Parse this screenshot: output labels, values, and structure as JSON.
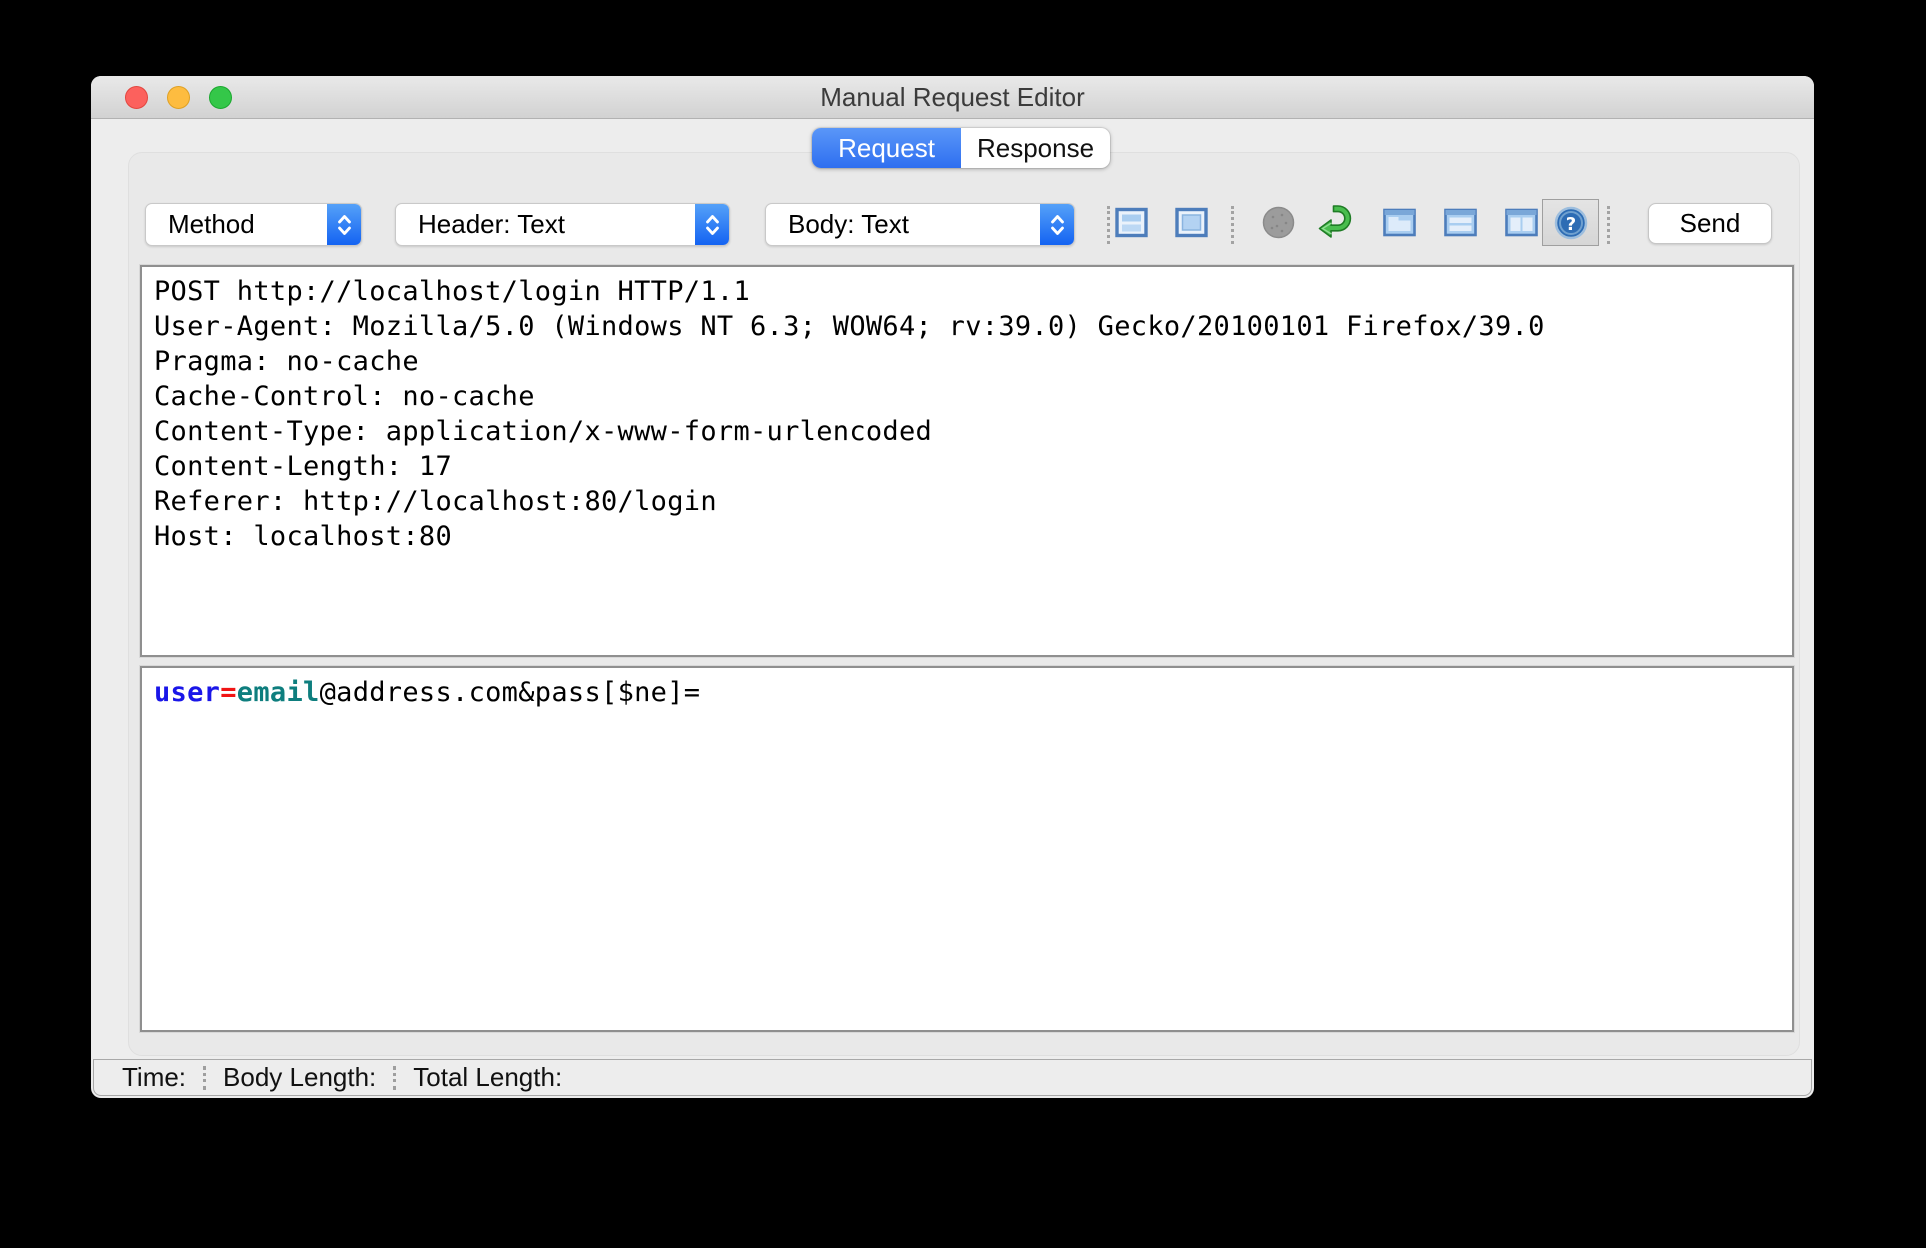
{
  "window": {
    "title": "Manual Request Editor"
  },
  "tabs": {
    "request": {
      "label": "Request",
      "selected": true
    },
    "response": {
      "label": "Response",
      "selected": false
    }
  },
  "toolbar": {
    "method_dropdown": {
      "value": "Method"
    },
    "header_dropdown": {
      "value": "Header: Text"
    },
    "body_dropdown": {
      "value": "Body: Text"
    },
    "icons": [
      "combined-view-icon",
      "single-view-icon",
      "break-icon",
      "follow-redirects-icon",
      "tab-view-icon",
      "horizontal-split-view-icon",
      "vertical-split-view-icon",
      "help-icon"
    ],
    "send_label": "Send"
  },
  "request": {
    "header_lines": [
      "POST http://localhost/login HTTP/1.1",
      "User-Agent: Mozilla/5.0 (Windows NT 6.3; WOW64; rv:39.0) Gecko/20100101 Firefox/39.0",
      "Pragma: no-cache",
      "Cache-Control: no-cache",
      "Content-Type: application/x-www-form-urlencoded",
      "Content-Length: 17",
      "Referer: http://localhost:80/login",
      "Host: localhost:80"
    ],
    "body_segments": {
      "param": "user",
      "equals": "=",
      "value_highlight": "email",
      "rest": "@address.com&pass[$ne]="
    }
  },
  "status_bar": {
    "time_label": "Time:",
    "body_length_label": "Body Length:",
    "total_length_label": "Total Length:"
  },
  "colors": {
    "selected_tab_blue": "#2e6ff0",
    "dropdown_accent_blue": "#1463f2",
    "body_param_blue": "#1a16e8",
    "body_equals_red": "#f01414",
    "body_value_teal": "#0e7e7e",
    "traffic_red": "#fc615d",
    "traffic_yellow": "#fdbc40",
    "traffic_green": "#34c749"
  }
}
